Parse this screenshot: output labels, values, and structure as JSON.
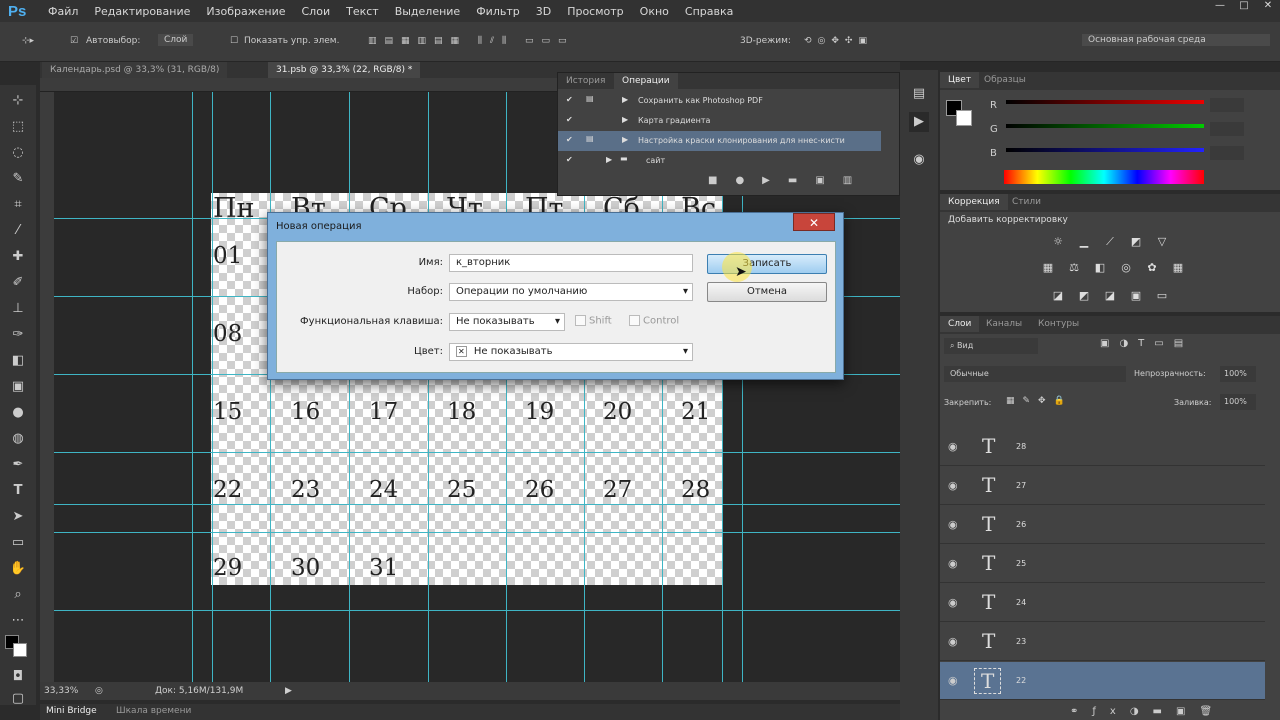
{
  "menu": {
    "logo": "Ps",
    "items": [
      "Файл",
      "Редактирование",
      "Изображение",
      "Слои",
      "Текст",
      "Выделение",
      "Фильтр",
      "3D",
      "Просмотр",
      "Окно",
      "Справка"
    ]
  },
  "window": {
    "minimize": "—",
    "maximize": "□",
    "close": "✕"
  },
  "options": {
    "autoselect": "Автовыбор:",
    "layer": "Слой",
    "show_controls": "Показать упр. элем.",
    "mode3d": "3D-режим:",
    "workspace": "Основная рабочая среда"
  },
  "tabs": [
    "Календарь.psd @ 33,3% (31, RGB/8)",
    "31.psb @ 33,3% (22, RGB/8) *"
  ],
  "ops_panel": {
    "tabs": [
      "История",
      "Операции"
    ],
    "rows": [
      "Сохранить как Photoshop PDF",
      "Карта градиента",
      "Настройка краски клонирования для ннес-кисти",
      "сайт"
    ]
  },
  "calendar": {
    "headers": [
      "Пн",
      "Вт",
      "Ср",
      "Чт",
      "Пт",
      "Сб",
      "Вс"
    ],
    "rows": [
      [
        "01"
      ],
      [
        "08"
      ],
      [
        "15",
        "16",
        "17",
        "18",
        "19",
        "20",
        "21"
      ],
      [
        "22",
        "23",
        "24",
        "25",
        "26",
        "27",
        "28"
      ],
      [
        "29",
        "30",
        "31"
      ]
    ]
  },
  "dialog": {
    "title": "Новая операция",
    "close": "✕",
    "name_label": "Имя:",
    "name_value": "к_вторник",
    "set_label": "Набор:",
    "set_value": "Операции по умолчанию",
    "fkey_label": "Функциональная клавиша:",
    "fkey_value": "Не показывать",
    "shift": "Shift",
    "control": "Control",
    "color_label": "Цвет:",
    "color_x": "✕",
    "color_value": "Не показывать",
    "record": "Записать",
    "cancel": "Отмена"
  },
  "status": {
    "zoom": "33,33%",
    "doc": "Док: 5,16M/131,9M"
  },
  "bottom_tabs": [
    "Mini Bridge",
    "Шкала времени"
  ],
  "color_panel": {
    "tabs": [
      "Цвет",
      "Образцы"
    ],
    "channels": [
      "R",
      "G",
      "B"
    ]
  },
  "adjust_panel": {
    "tabs": [
      "Коррекция",
      "Стили"
    ],
    "subtitle": "Добавить корректировку"
  },
  "layers_panel": {
    "tabs": [
      "Слои",
      "Каналы",
      "Контуры"
    ],
    "kind": "Вид",
    "blend": "Обычные",
    "opacity_label": "Непрозрачность:",
    "opacity": "100%",
    "lock_label": "Закрепить:",
    "fill_label": "Заливка:",
    "fill": "100%",
    "layers": [
      "28",
      "27",
      "26",
      "25",
      "24",
      "23",
      "22"
    ]
  },
  "colors": {
    "accent": "#3fb5c4",
    "selected_layer": "#5a7392",
    "dialog_frame": "#7fb0dc"
  }
}
